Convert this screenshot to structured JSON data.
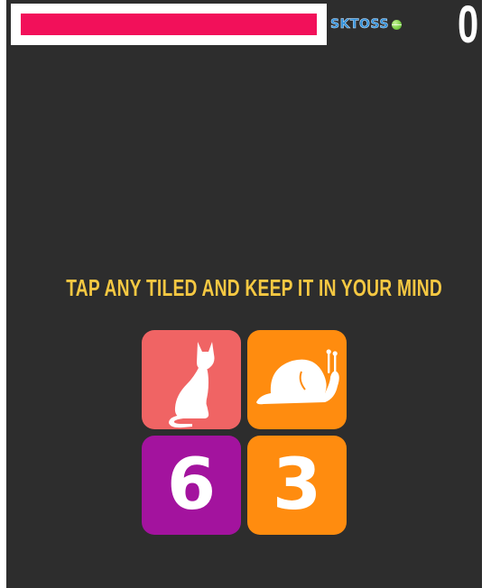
{
  "header": {
    "timer_remaining": 1.0,
    "brand": "SKTOSS",
    "score": "0"
  },
  "game": {
    "instruction": "TAP ANY TILED AND KEEP IT IN YOUR MIND",
    "tiles": [
      {
        "kind": "icon",
        "icon": "cat-icon",
        "color": "#f06464"
      },
      {
        "kind": "icon",
        "icon": "snail-icon",
        "color": "#ff8c0f"
      },
      {
        "kind": "number",
        "value": "6",
        "color": "#a3139e"
      },
      {
        "kind": "number",
        "value": "3",
        "color": "#ff8c0f"
      }
    ]
  },
  "colors": {
    "background": "#2d2d2d",
    "timer": "#f2105a",
    "instruction": "#f5c842"
  }
}
